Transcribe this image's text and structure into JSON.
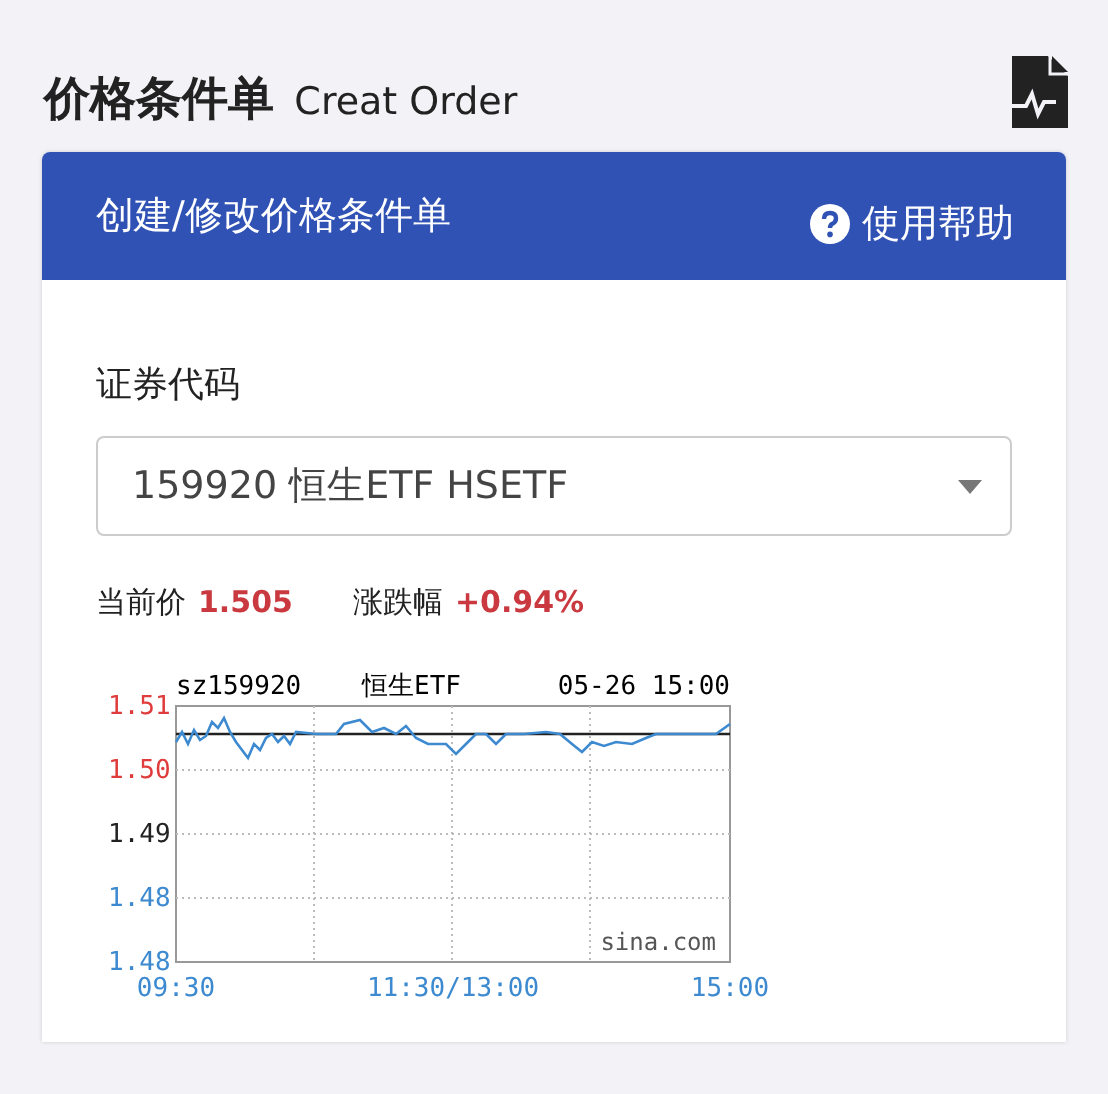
{
  "page_title": {
    "main": "价格条件单",
    "sub": "Creat Order"
  },
  "card": {
    "title": "创建/修改价格条件单",
    "help": "使用帮助"
  },
  "security": {
    "label": "证券代码",
    "value": "159920 恒生ETF HSETF"
  },
  "quote": {
    "price_label": "当前价",
    "price": "1.505",
    "change_label": "涨跌幅",
    "change": "+0.94%"
  },
  "price_chart": {
    "code": "sz159920",
    "name": "恒生ETF",
    "time": "05-26 15:00",
    "watermark": "sina.com",
    "y_labels": [
      {
        "text": "1.51",
        "color": "#e03c3c"
      },
      {
        "text": "1.50",
        "color": "#e03c3c"
      },
      {
        "text": "1.49",
        "color": "#222222"
      },
      {
        "text": "1.48",
        "color": "#3d8ad0"
      },
      {
        "text": "1.48",
        "color": "#3d8ad0"
      }
    ],
    "x_labels": [
      "09:30",
      "11:30/13:00",
      "15:00"
    ]
  }
}
